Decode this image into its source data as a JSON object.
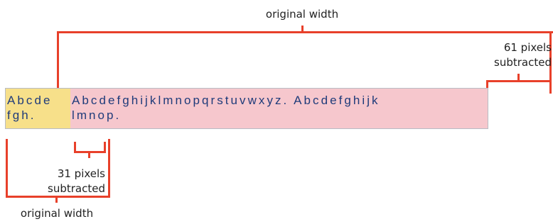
{
  "colors": {
    "accent": "#e8402a",
    "highlight_yellow": "#f7e08a",
    "highlight_pink": "#f6c7cd",
    "text": "#1f3b7a",
    "box_border": "#b8bcc4"
  },
  "labels": {
    "top_original_width": "original width",
    "bottom_original_width": "original width",
    "right_subtracted_line1": "61 pixels",
    "right_subtracted_line2": "subtracted",
    "left_subtracted_line1": "31 pixels",
    "left_subtracted_line2": "subtracted"
  },
  "sample": {
    "yellow_line1": "Abcde",
    "yellow_line2": "fgh.",
    "pink_line1": "Abcdefghijklmnopqrstuvwxyz. Abcdefghijk",
    "pink_line2": "lmnop."
  }
}
